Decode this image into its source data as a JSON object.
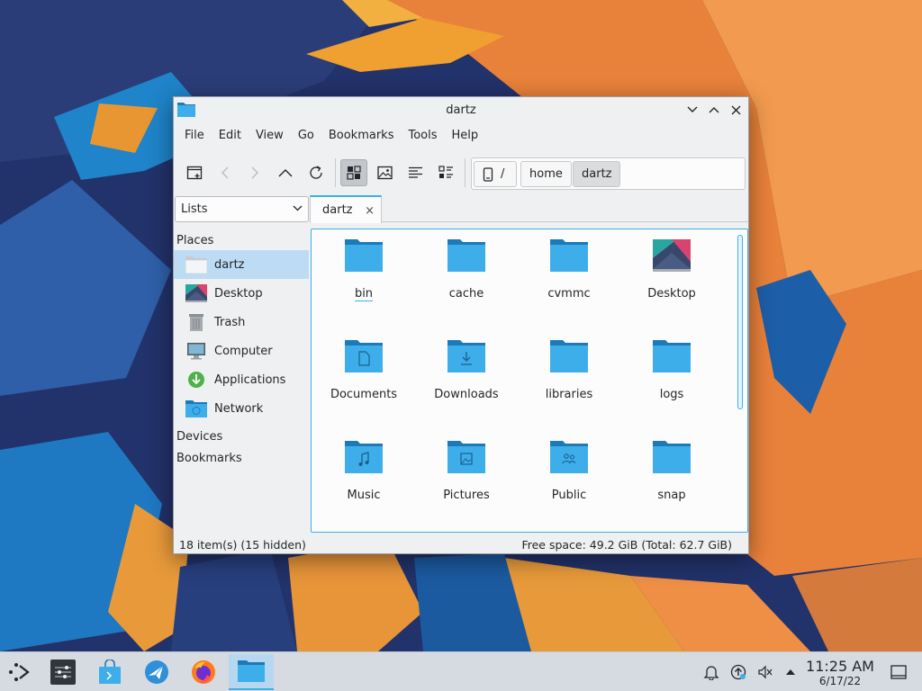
{
  "window": {
    "title": "dartz",
    "menu": [
      "File",
      "Edit",
      "View",
      "Go",
      "Bookmarks",
      "Tools",
      "Help"
    ]
  },
  "breadcrumb": {
    "root": "/",
    "items": [
      "home",
      "dartz"
    ]
  },
  "sidebar": {
    "panel_select": "Lists",
    "places_heading": "Places",
    "places": [
      {
        "label": "dartz",
        "icon": "home-folder-icon"
      },
      {
        "label": "Desktop",
        "icon": "desktop-icon"
      },
      {
        "label": "Trash",
        "icon": "trash-icon"
      },
      {
        "label": "Computer",
        "icon": "computer-icon"
      },
      {
        "label": "Applications",
        "icon": "applications-icon"
      },
      {
        "label": "Network",
        "icon": "network-icon"
      }
    ],
    "devices_heading": "Devices",
    "bookmarks_heading": "Bookmarks"
  },
  "tab": {
    "label": "dartz",
    "close": "×"
  },
  "files": [
    {
      "name": "bin",
      "icon": "folder"
    },
    {
      "name": "cache",
      "icon": "folder"
    },
    {
      "name": "cvmmc",
      "icon": "folder"
    },
    {
      "name": "Desktop",
      "icon": "desktop"
    },
    {
      "name": "Documents",
      "icon": "folder-documents"
    },
    {
      "name": "Downloads",
      "icon": "folder-downloads"
    },
    {
      "name": "libraries",
      "icon": "folder"
    },
    {
      "name": "logs",
      "icon": "folder"
    },
    {
      "name": "Music",
      "icon": "folder-music"
    },
    {
      "name": "Pictures",
      "icon": "folder-pictures"
    },
    {
      "name": "Public",
      "icon": "folder-public"
    },
    {
      "name": "snap",
      "icon": "folder"
    }
  ],
  "status": {
    "items": "18 item(s) (15 hidden)",
    "space": "Free space: 49.2 GiB (Total: 62.7 GiB)"
  },
  "taskbar": {
    "time": "11:25 AM",
    "date": "6/17/22"
  },
  "colors": {
    "accent": "#3daee9",
    "folder": "#3daee9",
    "folder_dark": "#1d7ab8"
  }
}
